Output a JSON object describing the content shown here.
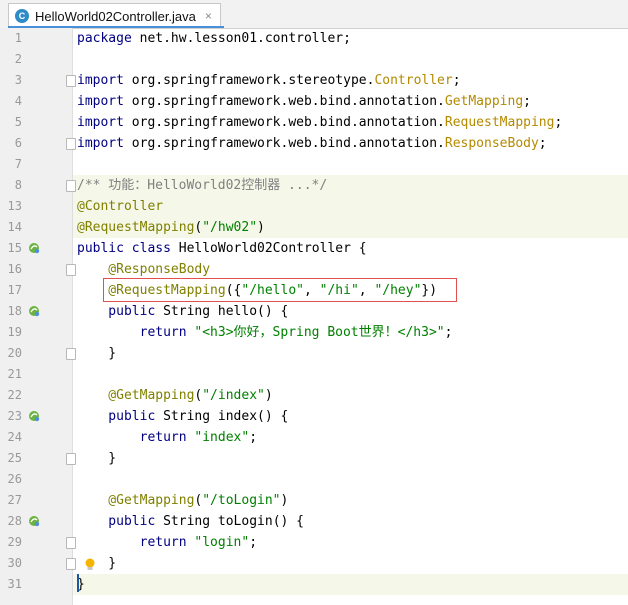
{
  "tab": {
    "title": "HelloWorld02Controller.java",
    "icon_letter": "C",
    "close_glyph": "×"
  },
  "lines": [
    {
      "num": "1",
      "tokens": [
        {
          "t": "package ",
          "c": "kw"
        },
        {
          "t": "net.hw.lesson01.controller;",
          "c": "pkg"
        }
      ]
    },
    {
      "num": "2",
      "tokens": []
    },
    {
      "num": "3",
      "tokens": [
        {
          "t": "import ",
          "c": "kw"
        },
        {
          "t": "org.springframework.stereotype.",
          "c": "pkg"
        },
        {
          "t": "Controller",
          "c": "imp-last"
        },
        {
          "t": ";",
          "c": "pkg"
        }
      ]
    },
    {
      "num": "4",
      "tokens": [
        {
          "t": "import ",
          "c": "kw"
        },
        {
          "t": "org.springframework.web.bind.annotation.",
          "c": "pkg"
        },
        {
          "t": "GetMapping",
          "c": "imp-last"
        },
        {
          "t": ";",
          "c": "pkg"
        }
      ]
    },
    {
      "num": "5",
      "tokens": [
        {
          "t": "import ",
          "c": "kw"
        },
        {
          "t": "org.springframework.web.bind.annotation.",
          "c": "pkg"
        },
        {
          "t": "RequestMapping",
          "c": "imp-last"
        },
        {
          "t": ";",
          "c": "pkg"
        }
      ]
    },
    {
      "num": "6",
      "tokens": [
        {
          "t": "import ",
          "c": "kw"
        },
        {
          "t": "org.springframework.web.bind.annotation.",
          "c": "pkg"
        },
        {
          "t": "ResponseBody",
          "c": "imp-last"
        },
        {
          "t": ";",
          "c": "pkg"
        }
      ]
    },
    {
      "num": "7",
      "tokens": []
    },
    {
      "num": "8",
      "tokens": [
        {
          "t": "/** 功能：HelloWorld02控制器 ...*/",
          "c": "cmt"
        }
      ]
    },
    {
      "num": "13",
      "tokens": [
        {
          "t": "@Controller",
          "c": "ann"
        }
      ]
    },
    {
      "num": "14",
      "tokens": [
        {
          "t": "@RequestMapping",
          "c": "ann"
        },
        {
          "t": "(",
          "c": "pkg"
        },
        {
          "t": "\"/hw02\"",
          "c": "str"
        },
        {
          "t": ")",
          "c": "pkg"
        }
      ]
    },
    {
      "num": "15",
      "tokens": [
        {
          "t": "public class ",
          "c": "kw"
        },
        {
          "t": "HelloWorld02Controller ",
          "c": "type"
        },
        {
          "t": "{",
          "c": "brace"
        }
      ]
    },
    {
      "num": "16",
      "tokens": [
        {
          "t": "    @ResponseBody",
          "c": "ann"
        }
      ]
    },
    {
      "num": "17",
      "tokens": [
        {
          "t": "    @RequestMapping",
          "c": "ann"
        },
        {
          "t": "({",
          "c": "pkg"
        },
        {
          "t": "\"/hello\"",
          "c": "str"
        },
        {
          "t": ", ",
          "c": "pkg"
        },
        {
          "t": "\"/hi\"",
          "c": "str"
        },
        {
          "t": ", ",
          "c": "pkg"
        },
        {
          "t": "\"/hey\"",
          "c": "str"
        },
        {
          "t": "})",
          "c": "pkg"
        }
      ]
    },
    {
      "num": "18",
      "tokens": [
        {
          "t": "    public ",
          "c": "kw"
        },
        {
          "t": "String ",
          "c": "type"
        },
        {
          "t": "hello",
          "c": "type"
        },
        {
          "t": "() {",
          "c": "pkg"
        }
      ]
    },
    {
      "num": "19",
      "tokens": [
        {
          "t": "        return ",
          "c": "kw"
        },
        {
          "t": "\"<h3>你好，Spring Boot世界！</h3>\"",
          "c": "str"
        },
        {
          "t": ";",
          "c": "pkg"
        }
      ]
    },
    {
      "num": "20",
      "tokens": [
        {
          "t": "    }",
          "c": "pkg"
        }
      ]
    },
    {
      "num": "21",
      "tokens": []
    },
    {
      "num": "22",
      "tokens": [
        {
          "t": "    @GetMapping",
          "c": "ann"
        },
        {
          "t": "(",
          "c": "pkg"
        },
        {
          "t": "\"/index\"",
          "c": "str"
        },
        {
          "t": ")",
          "c": "pkg"
        }
      ]
    },
    {
      "num": "23",
      "tokens": [
        {
          "t": "    public ",
          "c": "kw"
        },
        {
          "t": "String ",
          "c": "type"
        },
        {
          "t": "index",
          "c": "type"
        },
        {
          "t": "() {",
          "c": "pkg"
        }
      ]
    },
    {
      "num": "24",
      "tokens": [
        {
          "t": "        return ",
          "c": "kw"
        },
        {
          "t": "\"index\"",
          "c": "str"
        },
        {
          "t": ";",
          "c": "pkg"
        }
      ]
    },
    {
      "num": "25",
      "tokens": [
        {
          "t": "    }",
          "c": "pkg"
        }
      ]
    },
    {
      "num": "26",
      "tokens": []
    },
    {
      "num": "27",
      "tokens": [
        {
          "t": "    @GetMapping",
          "c": "ann"
        },
        {
          "t": "(",
          "c": "pkg"
        },
        {
          "t": "\"/toLogin\"",
          "c": "str"
        },
        {
          "t": ")",
          "c": "pkg"
        }
      ]
    },
    {
      "num": "28",
      "tokens": [
        {
          "t": "    public ",
          "c": "kw"
        },
        {
          "t": "String ",
          "c": "type"
        },
        {
          "t": "toLogin",
          "c": "type"
        },
        {
          "t": "() {",
          "c": "pkg"
        }
      ]
    },
    {
      "num": "29",
      "tokens": [
        {
          "t": "        return ",
          "c": "kw"
        },
        {
          "t": "\"login\"",
          "c": "str"
        },
        {
          "t": ";",
          "c": "pkg"
        }
      ]
    },
    {
      "num": "30",
      "tokens": [
        {
          "t": "    }",
          "c": "pkg"
        }
      ]
    },
    {
      "num": "31",
      "tokens": [
        {
          "t": "}",
          "c": "brace"
        }
      ]
    }
  ],
  "colors": {
    "keyword": "#000080",
    "string": "#008000",
    "annotation": "#808000",
    "comment": "#808080",
    "highlight_box": "#e05050"
  }
}
